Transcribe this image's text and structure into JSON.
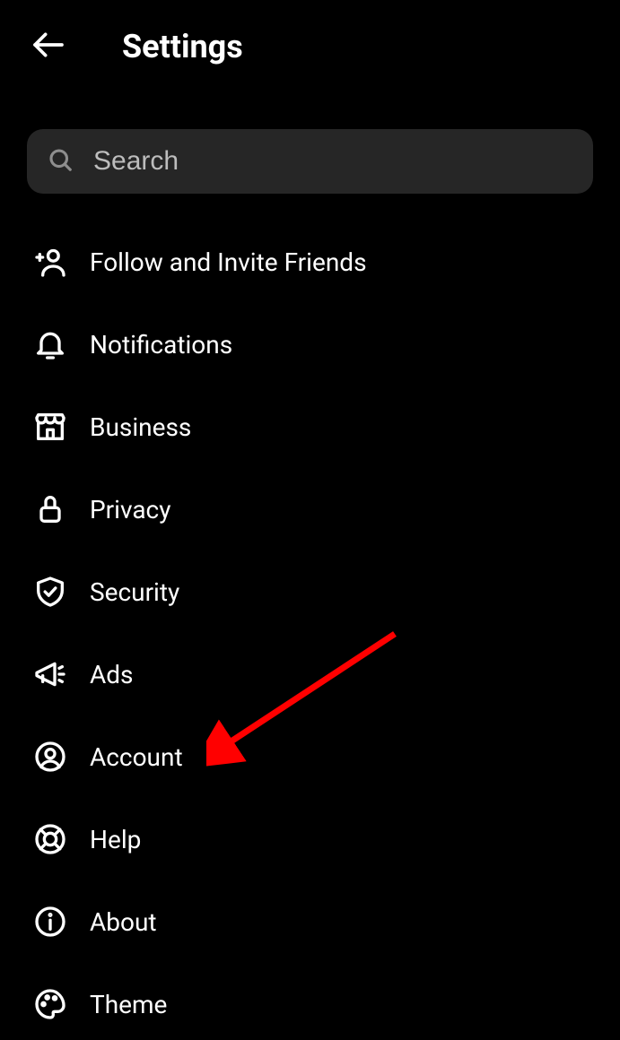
{
  "header": {
    "title": "Settings"
  },
  "search": {
    "placeholder": "Search"
  },
  "menu": {
    "items": [
      {
        "label": "Follow and Invite Friends"
      },
      {
        "label": "Notifications"
      },
      {
        "label": "Business"
      },
      {
        "label": "Privacy"
      },
      {
        "label": "Security"
      },
      {
        "label": "Ads"
      },
      {
        "label": "Account"
      },
      {
        "label": "Help"
      },
      {
        "label": "About"
      },
      {
        "label": "Theme"
      }
    ]
  },
  "annotation": {
    "arrow_color": "#ff0000",
    "points_to": "Account"
  }
}
